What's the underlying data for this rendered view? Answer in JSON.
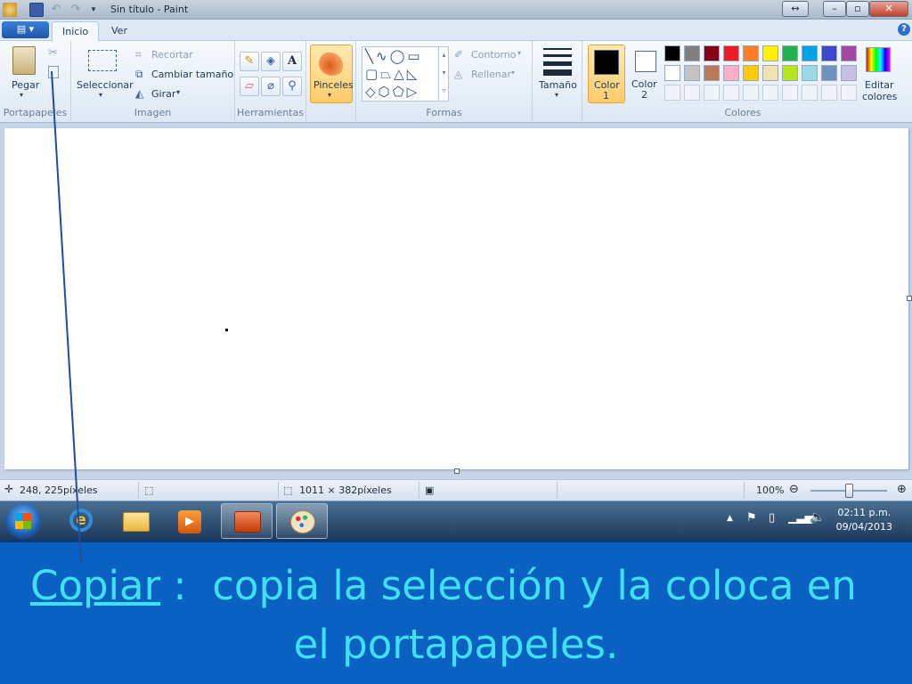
{
  "window": {
    "title": "Sin título - Paint"
  },
  "tabs": [
    {
      "label": "Inicio",
      "active": true
    },
    {
      "label": "Ver",
      "active": false
    }
  ],
  "ribbon": {
    "clipboard": {
      "group_label": "Portapapeles",
      "paste": "Pegar"
    },
    "image": {
      "group_label": "Imagen",
      "select": "Seleccionar",
      "crop": "Recortar",
      "resize": "Cambiar tamaño",
      "rotate": "Girar"
    },
    "tools": {
      "group_label": "Herramientas"
    },
    "brushes": {
      "label": "Pinceles"
    },
    "shapes": {
      "group_label": "Formas",
      "outline": "Contorno",
      "fill": "Rellenar"
    },
    "size": {
      "label": "Tamaño"
    },
    "colors": {
      "group_label": "Colores",
      "color1": "Color\n1",
      "color1_line1": "Color",
      "color1_line2": "1",
      "color2_line1": "Color",
      "color2_line2": "2",
      "edit_line1": "Editar",
      "edit_line2": "colores",
      "color1_value": "#000000",
      "color2_value": "#ffffff",
      "palette_row1": [
        "#000000",
        "#7f7f7f",
        "#880015",
        "#ed1c24",
        "#ff7f27",
        "#fff200",
        "#22b14c",
        "#00a2e8",
        "#3f48cc",
        "#a349a4"
      ],
      "palette_row2": [
        "#ffffff",
        "#c3c3c3",
        "#b97a57",
        "#ffaec9",
        "#ffc90e",
        "#efe4b0",
        "#b5e61d",
        "#99d9ea",
        "#7092be",
        "#c8bfe7"
      ]
    }
  },
  "statusbar": {
    "cursor_pos": "248, 225píxeles",
    "canvas_size": "1011 × 382píxeles",
    "zoom": "100%"
  },
  "taskbar": {
    "time": "02:11 p.m.",
    "date": "09/04/2013"
  },
  "caption": {
    "keyword": "Copiar",
    "separator": " :  ",
    "line1_rest": "copia la selección y la coloca en",
    "line2": "el portapapeles."
  },
  "colors": {
    "caption_text": "#3fe0f2",
    "caption_bg": "#0b61c2"
  }
}
